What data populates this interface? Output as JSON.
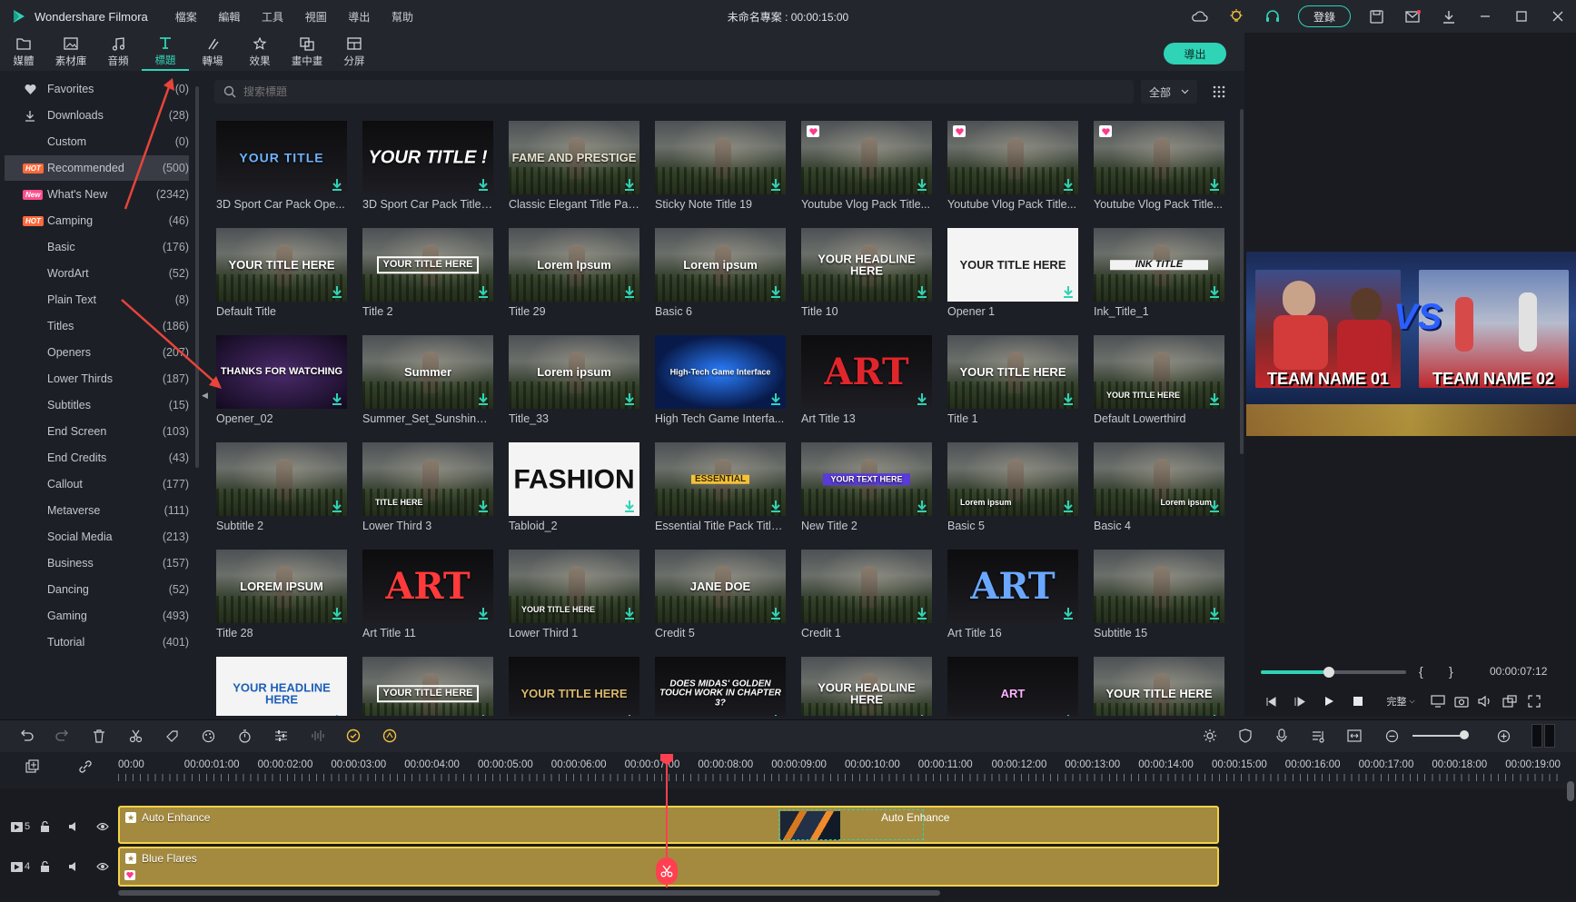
{
  "app": {
    "name": "Wondershare Filmora",
    "menu": [
      "檔案",
      "編輯",
      "工具",
      "視圖",
      "導出",
      "幫助"
    ],
    "project_title": "未命名專案 : 00:00:15:00",
    "login_label": "登錄",
    "export_label": "導出"
  },
  "toolbar": [
    {
      "label": "媒體",
      "icon": "folder-icon"
    },
    {
      "label": "素材庫",
      "icon": "image-library-icon"
    },
    {
      "label": "音頻",
      "icon": "music-note-icon"
    },
    {
      "label": "標題",
      "icon": "title-t-icon",
      "active": true
    },
    {
      "label": "轉場",
      "icon": "transition-icon"
    },
    {
      "label": "效果",
      "icon": "effects-icon"
    },
    {
      "label": "畫中畫",
      "icon": "picture-in-picture-icon"
    },
    {
      "label": "分屏",
      "icon": "split-screen-icon"
    }
  ],
  "sidebar": {
    "items": [
      {
        "name": "Favorites",
        "count": "(0)",
        "icon": "heart"
      },
      {
        "name": "Downloads",
        "count": "(28)",
        "icon": "download"
      },
      {
        "name": "Custom",
        "count": "(0)"
      },
      {
        "name": "Recommended",
        "count": "(500)",
        "badge": "HOT",
        "selected": true
      },
      {
        "name": "What's New",
        "count": "(2342)",
        "badge": "New"
      },
      {
        "name": "Camping",
        "count": "(46)",
        "badge": "HOT"
      },
      {
        "name": "Basic",
        "count": "(176)"
      },
      {
        "name": "WordArt",
        "count": "(52)"
      },
      {
        "name": "Plain Text",
        "count": "(8)"
      },
      {
        "name": "Titles",
        "count": "(186)"
      },
      {
        "name": "Openers",
        "count": "(207)"
      },
      {
        "name": "Lower Thirds",
        "count": "(187)"
      },
      {
        "name": "Subtitles",
        "count": "(15)"
      },
      {
        "name": "End Screen",
        "count": "(103)"
      },
      {
        "name": "End Credits",
        "count": "(43)"
      },
      {
        "name": "Callout",
        "count": "(177)"
      },
      {
        "name": "Metaverse",
        "count": "(111)"
      },
      {
        "name": "Social Media",
        "count": "(213)"
      },
      {
        "name": "Business",
        "count": "(157)"
      },
      {
        "name": "Dancing",
        "count": "(52)"
      },
      {
        "name": "Gaming",
        "count": "(493)"
      },
      {
        "name": "Tutorial",
        "count": "(401)"
      }
    ]
  },
  "search": {
    "placeholder": "搜索標題",
    "filter_label": "全部"
  },
  "grid": {
    "items": [
      {
        "label": "3D Sport Car Pack Ope...",
        "thumb_text": "YOUR TITLE",
        "style": "dark-glitch",
        "thumb_color": "#6fb3ff"
      },
      {
        "label": "3D Sport Car Pack Title ...",
        "thumb_text": "YOUR TITLE !",
        "style": "dark",
        "thumb_color": "#ffffff"
      },
      {
        "label": "Classic Elegant Title Pac...",
        "thumb_text": "FAME AND PRESTIGE",
        "style": "field",
        "thumb_color": "#e8e2cf"
      },
      {
        "label": "Sticky Note Title 19",
        "thumb_text": "",
        "style": "field"
      },
      {
        "label": "Youtube Vlog Pack Title...",
        "thumb_text": "",
        "style": "field",
        "heart": true
      },
      {
        "label": "Youtube Vlog Pack Title...",
        "thumb_text": "",
        "style": "field",
        "heart": true
      },
      {
        "label": "Youtube Vlog Pack Title...",
        "thumb_text": "",
        "style": "field",
        "heart": true
      },
      {
        "label": "Default Title",
        "thumb_text": "YOUR TITLE HERE",
        "style": "field",
        "thumb_color": "#ffffff"
      },
      {
        "label": "Title 2",
        "thumb_text": "YOUR TITLE HERE",
        "style": "field-box",
        "thumb_color": "#ffffff"
      },
      {
        "label": "Title 29",
        "thumb_text": "Lorem Ipsum",
        "style": "field",
        "thumb_color": "#ffffff"
      },
      {
        "label": "Basic 6",
        "thumb_text": "Lorem ipsum",
        "style": "field",
        "thumb_color": "#ffffff"
      },
      {
        "label": "Title 10",
        "thumb_text": "YOUR HEADLINE HERE",
        "style": "field-blue",
        "thumb_color": "#ffffff"
      },
      {
        "label": "Opener 1",
        "thumb_text": "YOUR TITLE HERE",
        "style": "white",
        "thumb_color": "#222222"
      },
      {
        "label": "Ink_Title_1",
        "thumb_text": "INK TITLE",
        "style": "field-ink",
        "thumb_color": "#111111"
      },
      {
        "label": "Opener_02",
        "thumb_text": "THANKS FOR WATCHING",
        "style": "purple",
        "thumb_color": "#ffffff"
      },
      {
        "label": "Summer_Set_Sunshine_...",
        "thumb_text": "Summer",
        "style": "field",
        "thumb_color": "#ffffff"
      },
      {
        "label": "Title_33",
        "thumb_text": "Lorem ipsum",
        "style": "field",
        "thumb_color": "#ffffff"
      },
      {
        "label": "High Tech Game Interfa...",
        "thumb_text": "High-Tech Game Interface",
        "style": "blue-tech",
        "thumb_color": "#ffffff"
      },
      {
        "label": "Art Title 13",
        "thumb_text": "ART",
        "style": "black-art",
        "thumb_color": "#e0262b"
      },
      {
        "label": "Title 1",
        "thumb_text": "YOUR TITLE HERE",
        "style": "field",
        "thumb_color": "#ffffff"
      },
      {
        "label": "Default Lowerthird",
        "thumb_text": "YOUR TITLE HERE",
        "style": "field-lower",
        "thumb_color": "#ffffff"
      },
      {
        "label": "Subtitle 2",
        "thumb_text": "",
        "style": "field"
      },
      {
        "label": "Lower Third 3",
        "thumb_text": "TITLE HERE",
        "style": "field-lower",
        "thumb_color": "#ffffff"
      },
      {
        "label": "Tabloid_2",
        "thumb_text": "FASHION",
        "style": "white-fashion",
        "thumb_color": "#111111"
      },
      {
        "label": "Essential Title Pack Title ...",
        "thumb_text": "ESSENTIAL",
        "style": "field-gold",
        "thumb_color": "#f2c23a"
      },
      {
        "label": "New Title 2",
        "thumb_text": "YOUR TEXT HERE",
        "style": "field-purple",
        "thumb_color": "#ffffff"
      },
      {
        "label": "Basic 5",
        "thumb_text": "Lorem ipsum",
        "style": "field-lower",
        "thumb_color": "#ffffff"
      },
      {
        "label": "Basic 4",
        "thumb_text": "Lorem ipsum",
        "style": "field-lower-r",
        "thumb_color": "#ffffff"
      },
      {
        "label": "Title 28",
        "thumb_text": "LOREM IPSUM",
        "style": "field",
        "thumb_color": "#ffffff"
      },
      {
        "label": "Art Title 11",
        "thumb_text": "ART",
        "style": "black-art2",
        "thumb_color": "#ff3a3a"
      },
      {
        "label": "Lower Third 1",
        "thumb_text": "YOUR TITLE HERE",
        "style": "field-lower",
        "thumb_color": "#ffffff"
      },
      {
        "label": "Credit 5",
        "thumb_text": "JANE DOE",
        "style": "field",
        "thumb_color": "#ffffff"
      },
      {
        "label": "Credit 1",
        "thumb_text": "",
        "style": "field-credit"
      },
      {
        "label": "Art Title 16",
        "thumb_text": "ART",
        "style": "black-art3",
        "thumb_color": "#6aa8ff"
      },
      {
        "label": "Subtitle 15",
        "thumb_text": "",
        "style": "field"
      },
      {
        "label": "",
        "thumb_text": "YOUR HEADLINE HERE",
        "style": "white-blue",
        "thumb_color": "#1d5fb8"
      },
      {
        "label": "",
        "thumb_text": "YOUR TITLE HERE",
        "style": "field-frame",
        "thumb_color": "#ffffff"
      },
      {
        "label": "",
        "thumb_text": "YOUR TITLE HERE",
        "style": "black-gold",
        "thumb_color": "#d9b86a"
      },
      {
        "label": "",
        "thumb_text": "DOES MIDAS' GOLDEN TOUCH WORK IN CHAPTER 3?",
        "style": "black-comic",
        "thumb_color": "#ffffff"
      },
      {
        "label": "",
        "thumb_text": "YOUR HEADLINE HERE",
        "style": "field",
        "thumb_color": "#ffffff"
      },
      {
        "label": "",
        "thumb_text": "ART",
        "style": "black-neon",
        "thumb_color": "#ffb3ff"
      },
      {
        "label": "",
        "thumb_text": "YOUR TITLE HERE",
        "style": "field",
        "thumb_color": "#ffffff"
      }
    ]
  },
  "preview": {
    "team1": "TEAM NAME 01",
    "team2": "TEAM NAME 02",
    "vs": "VS",
    "time": "00:00:07:12",
    "progress": 0.47,
    "quality_label": "完整"
  },
  "timeline": {
    "ruler": [
      "00:00",
      "00:00:01:00",
      "00:00:02:00",
      "00:00:03:00",
      "00:00:04:00",
      "00:00:05:00",
      "00:00:06:00",
      "00:00:07:00",
      "00:00:08:00",
      "00:00:09:00",
      "00:00:10:00",
      "00:00:11:00",
      "00:00:12:00",
      "00:00:13:00",
      "00:00:14:00",
      "00:00:15:00",
      "00:00:16:00",
      "00:00:17:00",
      "00:00:18:00",
      "00:00:19:00"
    ],
    "tracks": [
      {
        "number": "5",
        "clip": "Auto Enhance",
        "clip2": "Auto Enhance"
      },
      {
        "number": "4",
        "clip": "Blue Flares"
      }
    ]
  },
  "colors": {
    "accent": "#2fd3b5",
    "clip": "#a38a3f",
    "clip_border": "#f2d14a",
    "playhead": "#ff4050",
    "annotation": "#e8443a"
  }
}
